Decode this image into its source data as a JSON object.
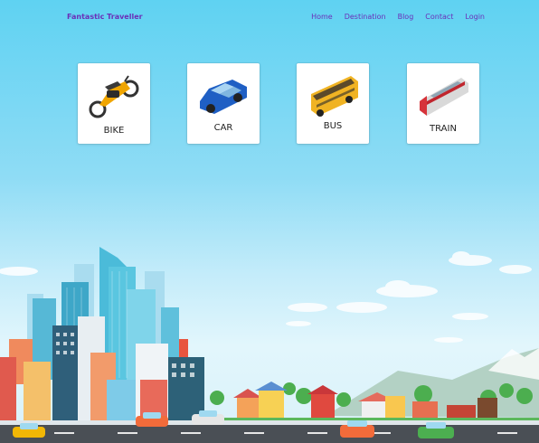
{
  "navbar": {
    "brand": "Fantastic Traveller",
    "links": [
      {
        "label": "Home"
      },
      {
        "label": "Destination"
      },
      {
        "label": "Blog"
      },
      {
        "label": "Contact"
      },
      {
        "label": "Login"
      }
    ]
  },
  "transport_options": [
    {
      "label": "BIKE",
      "icon": "motorbike-icon"
    },
    {
      "label": "CAR",
      "icon": "car-icon"
    },
    {
      "label": "BUS",
      "icon": "bus-icon"
    },
    {
      "label": "TRAIN",
      "icon": "train-icon"
    }
  ],
  "colors": {
    "brand": "#6a2fb8",
    "sky_top": "#5fd2f2",
    "road": "#4a4f55"
  }
}
